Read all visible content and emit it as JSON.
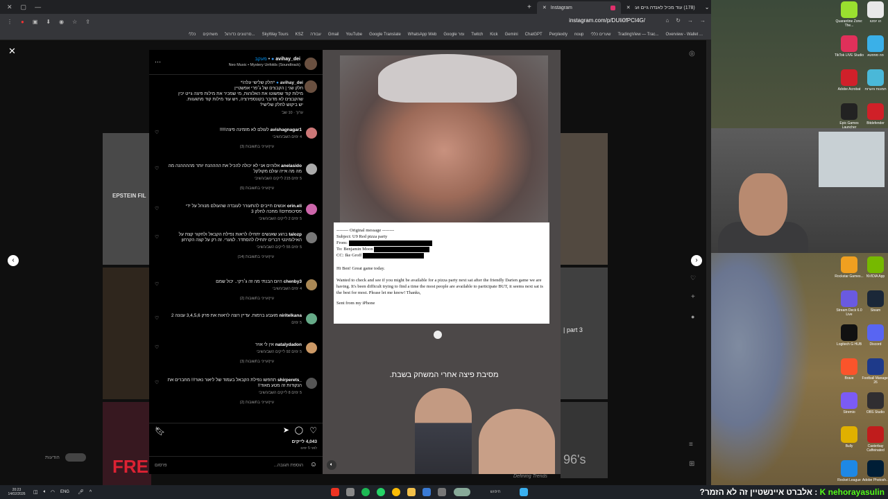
{
  "browser": {
    "tabs": [
      {
        "label": "Instagram",
        "active": true
      },
      {
        "label": "(178) עוד מכיל לאנדה גיים ועוד...",
        "active": false
      }
    ],
    "url": "instagram.com/p/DUIi0fPCI4G/",
    "bookmarks": [
      "Overview - Wallet ...",
      "TradingView — Trac...",
      "שערים כללי",
      "noup",
      "Perplexity",
      "ChatGPT",
      "Gemini",
      "Kick",
      "Twitch",
      "Google ומר",
      "WhatsApp Web",
      "Google Translate",
      "YouTube",
      "Gmail",
      "עבודה",
      "KSZ",
      "SkyWay Tours",
      "סרטונים כדורגל...",
      "משחקים",
      "כללי"
    ]
  },
  "post": {
    "author": "avihay_dei",
    "follow": "מעקב",
    "music": "Neo Music • Mystery Unfolds (Soundtrack)",
    "caption_user": "avihay_dei",
    "caption_title": "*חלק שלישי עלה!*",
    "caption_lines": [
      "חלק שני | הקבצים של ג׳פרי אפשטיין",
      "מילות קוד שפשוטו את האלוהות, מי שמכיר את מילות פיצה גייט יכין",
      "שהקבצים לא מדובר בקונספירציה, ויש עוד מילות קוד מתגעוות.",
      "יש ביקוש לחלק שלישי?"
    ],
    "caption_meta": "ערוך · 10 שב'",
    "likes": "4,043 לייקים",
    "date": "לפני 5 ימים",
    "add_comment": "הוספת תגובה...",
    "post_button": "פרסום",
    "overlay_caption": "מסיבת פיצה אחרי המשחק בשבת."
  },
  "comments": [
    {
      "user": "avishagnagar1",
      "text": "לעולם לא מזמינה פיצה!!!!!",
      "meta": "4 ימים   השב/השיבי",
      "replies": "עיין/עייני בתשובות (3)"
    },
    {
      "user": "anelasido",
      "text": "אלוהים אני לא יכולה להכיל את ההההנח יותר מההההנה מה מה מה אייה עולם מקולקל",
      "meta": "5 ימים   215 לייקים   השב/השיבי",
      "replies": "עיין/עייני בתשובות (5)"
    },
    {
      "user": "orin.eli",
      "text": "אנשים חייבים להתעורר לעובדה שהעולם מנוהל על ידי פסיכופתים!! מחכה לחלק 3",
      "meta": "5 ימים   2 לייקים   השב/השיבי",
      "replies": ""
    },
    {
      "user": "talozp",
      "text": "ברגע שאנשים יתחילו לראות נפילת הקבאל ולחקור קצת על האילומינטי דברים יתחילו להסתדר. לצערי. זה רק על קצה הקרחון",
      "meta": "5 ימים   55 לייקים   השב/השיבי",
      "replies": "עיין/עייני בתשובות (14)"
    },
    {
      "user": "chenby3",
      "text": "היום הבנתי מה זה ג׳רקי.. יכול שמם",
      "meta": "4 ימים   השב/השיבי",
      "replies": "עיין/עייני בתשובות (2)"
    },
    {
      "user": "niritelkana",
      "text": "מועבע ברמות. עדיין רוצה לראות את פרק 3,4,5,6 ענונה 2",
      "meta": "5 ימים",
      "replies": ""
    },
    {
      "user": "natalydadon",
      "text": "אין לי אויר",
      "meta": "5 ימים   92 לייקים   השב/השיבי",
      "replies": "עיין/עייני בתשובות (3)"
    },
    {
      "user": "_shirperets",
      "text": "תחפשו נפילת הקבאל בעמוד של ליאור נאור!!! מחברים את הנקודות זה מטע מאוד!!",
      "meta": "5 ימים   8 לייקים   השב/השיבי",
      "replies": "עיין/עייני בתשובות (2)"
    }
  ],
  "email": {
    "header": "-------- Original message --------",
    "subject": "Subject: U9 Red pizza party",
    "from": "From:",
    "to": "To: Benjamin Moon",
    "cc": "CC: Ike Groff",
    "greeting": "Hi Ben!  Great game today.",
    "body": "Wanted to check and see if you might be available for a pizza party next sat after the friendly Darien game we are having. It's been difficult trying to find a time the most people are available to participate BUT, it seems next sat is the best for most. Please let me know!  Thanks,",
    "signature": "Sent from my iPhone"
  },
  "background_labels": {
    "left": "EPSTEIN FIL",
    "right": "| part 3",
    "bottom_left": "FRE",
    "bottom_right": "96's",
    "bottom_right_sub": "Defining Trends"
  },
  "desktop_icons": [
    {
      "label": "Quarantine Zone: The...",
      "color": "#9ae02f"
    },
    {
      "label": "הו יוסטו",
      "color": "#e8e8e8"
    },
    {
      "label": "TikTok LIVE Studio",
      "color": "#e0305a"
    },
    {
      "label": "פה ספסטא",
      "color": "#3ab0e8"
    },
    {
      "label": "Adobe Acrobat",
      "color": "#d0202a"
    },
    {
      "label": "תמונות והערות",
      "color": "#4ab8d8"
    },
    {
      "label": "Epic Games Launcher",
      "color": "#222222"
    },
    {
      "label": "Bitdefender",
      "color": "#d02028"
    },
    {
      "label": "Rockstar Games...",
      "color": "#f0a020"
    },
    {
      "label": "NVIDIA App",
      "color": "#76b900"
    },
    {
      "label": "Stream Deck 6.0 Live",
      "color": "#6a5ae0"
    },
    {
      "label": "Steam",
      "color": "#1b2838"
    },
    {
      "label": "Logitech G HUB",
      "color": "#111111"
    },
    {
      "label": "Discord",
      "color": "#5865f2"
    },
    {
      "label": "Brave",
      "color": "#fb542b"
    },
    {
      "label": "Football Manager 26",
      "color": "#1e3a8a"
    },
    {
      "label": "Stremio",
      "color": "#7b5bf5"
    },
    {
      "label": "OBS Studio",
      "color": "#302e31"
    },
    {
      "label": "Bully",
      "color": "#e0b000"
    },
    {
      "label": "Casterbay Caffeinated",
      "color": "#c01c1c"
    },
    {
      "label": "Rocket League",
      "color": "#1e88e5"
    },
    {
      "label": "Adobe Photosh...",
      "color": "#001e36"
    }
  ],
  "taskbar": {
    "time": "20:23",
    "date": "14/02/2026",
    "lang": "ENG",
    "search": "חיפוש",
    "ticker_name": "nehorayasulin",
    "ticker_text": "אלברט איינשטיין זה לא הזמר?"
  },
  "colors": {
    "kick_green": "#53fc18",
    "ig_like": "#ff3040"
  }
}
